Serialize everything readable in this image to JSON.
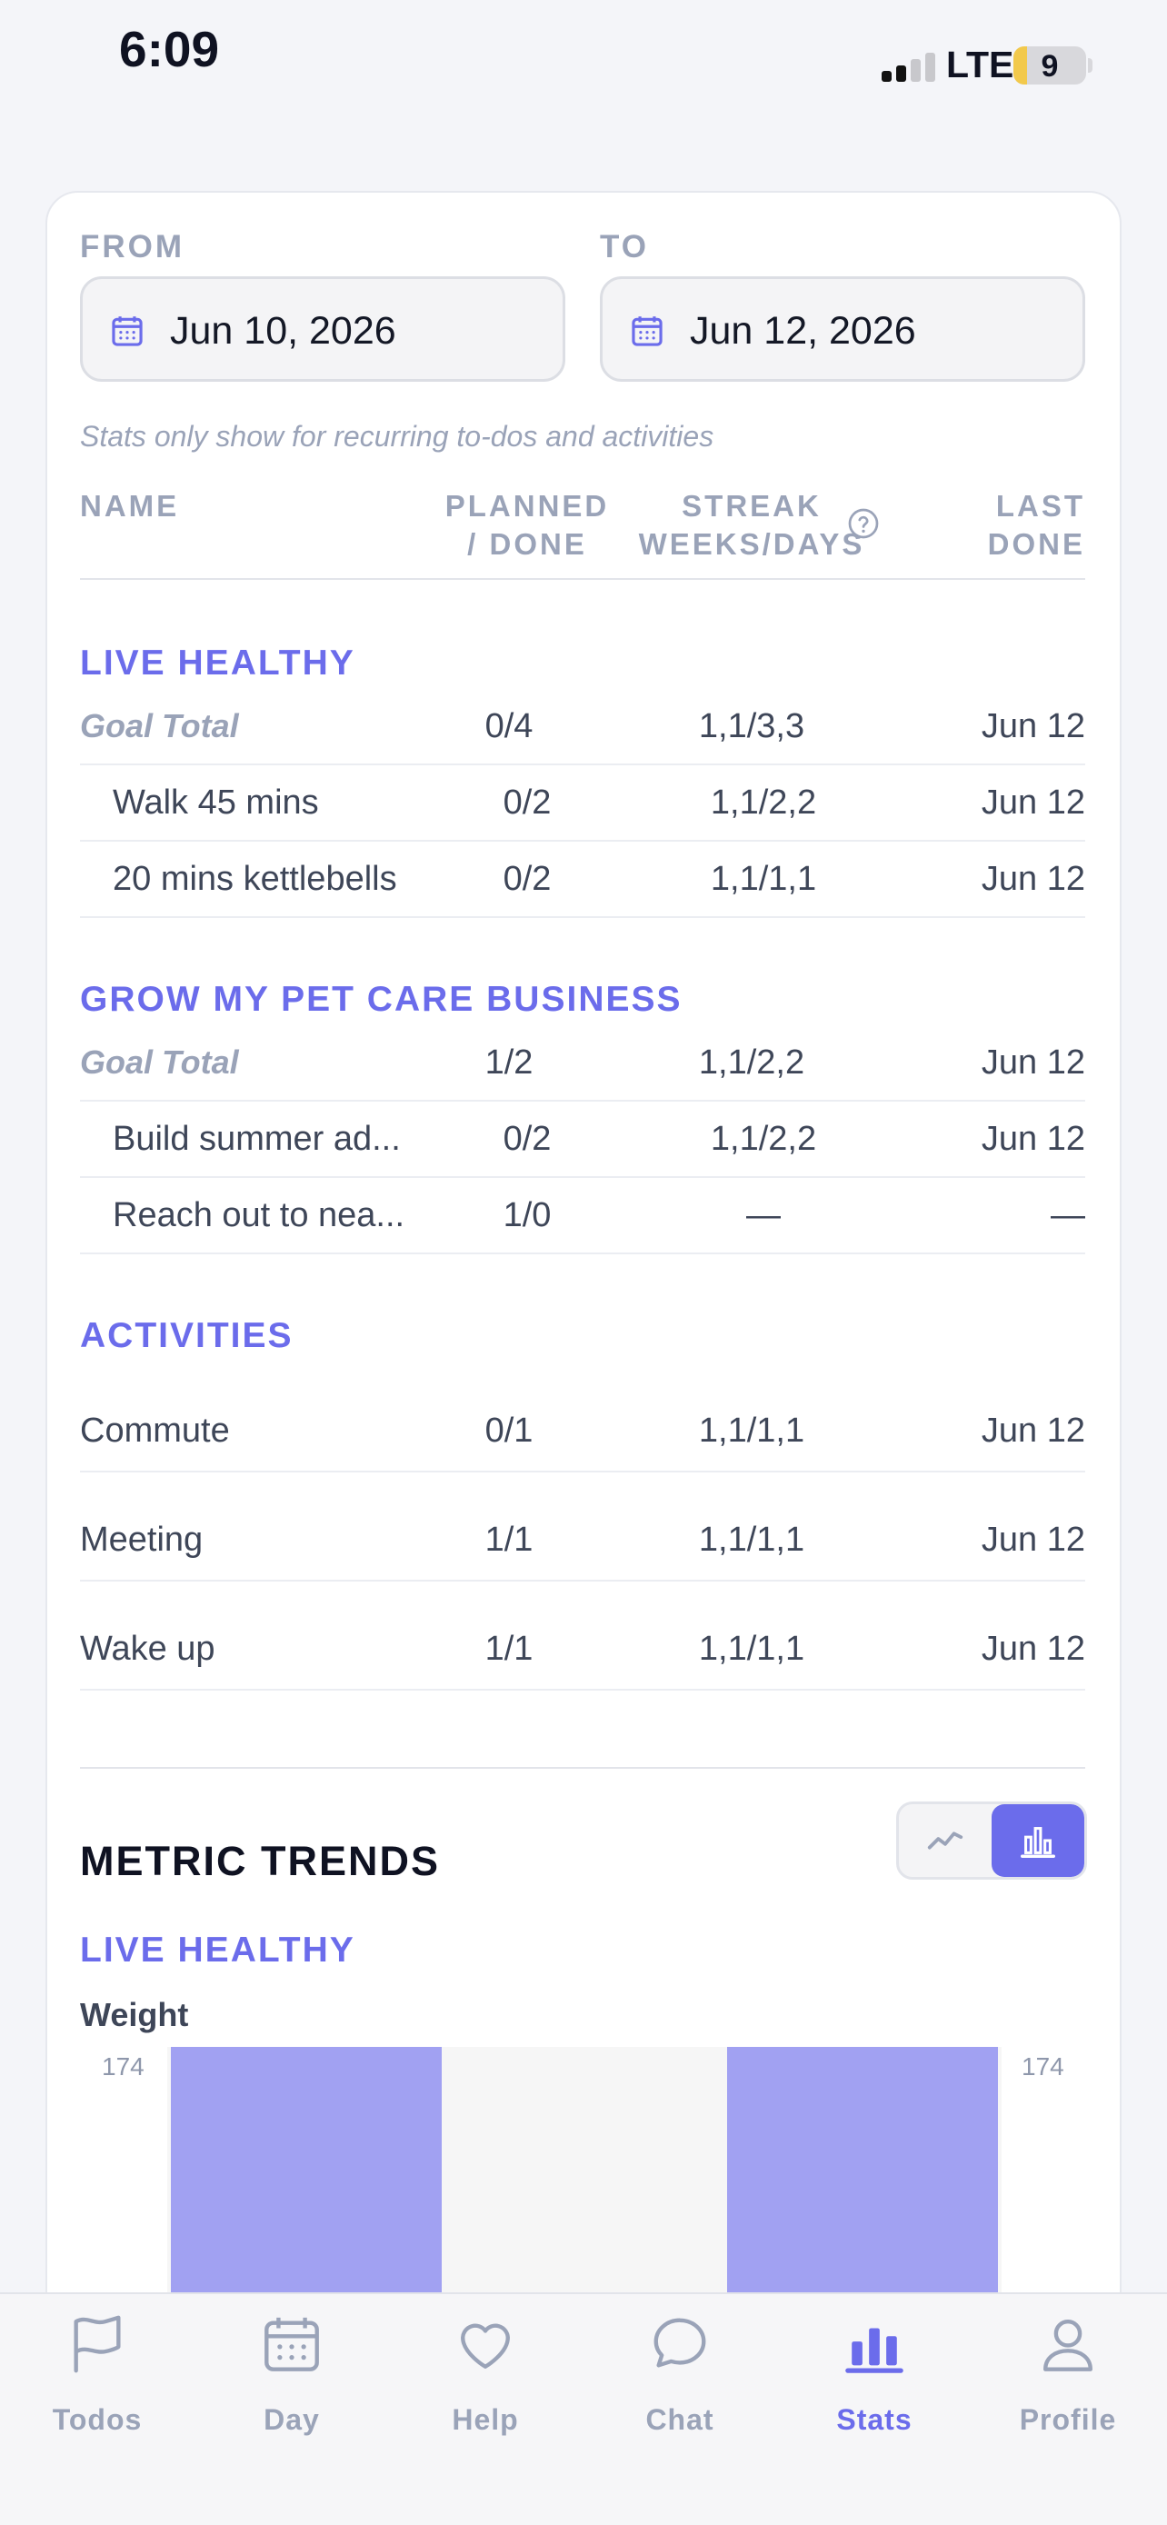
{
  "status_bar": {
    "time": "6:09",
    "network": "LTE",
    "battery": "9"
  },
  "date_range": {
    "from_label": "FROM",
    "to_label": "TO",
    "from_value": "Jun 10, 2026",
    "to_value": "Jun 12, 2026",
    "note": "Stats only show for recurring to-dos and activities"
  },
  "table_header": {
    "name": "NAME",
    "planned_line1": "PLANNED",
    "planned_line2": "/ DONE",
    "streak_line1": "STREAK",
    "streak_line2": "WEEKS/DAYS",
    "last_line1": "LAST",
    "last_line2": "DONE",
    "help_icon": "question-circle-icon"
  },
  "goals": [
    {
      "title": "LIVE HEALTHY",
      "total": {
        "name": "Goal Total",
        "planned": "0/4",
        "streak": "1,1/3,3",
        "last": "Jun 12"
      },
      "rows": [
        {
          "name": "Walk 45 mins",
          "planned": "0/2",
          "streak": "1,1/2,2",
          "last": "Jun 12"
        },
        {
          "name": "20 mins kettlebells",
          "planned": "0/2",
          "streak": "1,1/1,1",
          "last": "Jun 12"
        }
      ]
    },
    {
      "title": "GROW MY PET CARE BUSINESS",
      "total": {
        "name": "Goal Total",
        "planned": "1/2",
        "streak": "1,1/2,2",
        "last": "Jun 12"
      },
      "rows": [
        {
          "name": "Build summer ad...",
          "planned": "0/2",
          "streak": "1,1/2,2",
          "last": "Jun 12"
        },
        {
          "name": "Reach out to nea...",
          "planned": "1/0",
          "streak": "—",
          "last": "—"
        }
      ]
    }
  ],
  "activities": {
    "title": "ACTIVITIES",
    "rows": [
      {
        "name": "Commute",
        "planned": "0/1",
        "streak": "1,1/1,1",
        "last": "Jun 12"
      },
      {
        "name": "Meeting",
        "planned": "1/1",
        "streak": "1,1/1,1",
        "last": "Jun 12"
      },
      {
        "name": "Wake up",
        "planned": "1/1",
        "streak": "1,1/1,1",
        "last": "Jun 12"
      }
    ]
  },
  "metric_trends": {
    "title": "METRIC TRENDS",
    "toggle": {
      "options": [
        "line-chart-icon",
        "bar-chart-icon"
      ],
      "selected": "bar-chart-icon"
    },
    "goal_title": "LIVE HEALTHY",
    "metric_name": "Weight"
  },
  "chart_data": {
    "type": "bar",
    "title": "Weight",
    "y_ticks_left": [
      "174"
    ],
    "y_ticks_right": [
      "174"
    ],
    "bars": [
      {
        "value": 174,
        "filled": true
      },
      {
        "value": null,
        "filled": false
      },
      {
        "value": 174,
        "filled": true
      }
    ],
    "colors": {
      "bar": "#a1a1f2",
      "plot_background": "#f6f6f6"
    }
  },
  "tab_bar": {
    "tabs": [
      {
        "label": "Todos",
        "icon": "flag-icon",
        "active": false
      },
      {
        "label": "Day",
        "icon": "calendar-icon",
        "active": false
      },
      {
        "label": "Help",
        "icon": "heart-icon",
        "active": false
      },
      {
        "label": "Chat",
        "icon": "chat-bubble-icon",
        "active": false
      },
      {
        "label": "Stats",
        "icon": "bar-chart-icon",
        "active": true
      },
      {
        "label": "Profile",
        "icon": "user-icon",
        "active": false
      }
    ]
  },
  "colors": {
    "accent": "#6b6ceb",
    "muted": "#9aa3b8",
    "text": "#3e4658"
  }
}
